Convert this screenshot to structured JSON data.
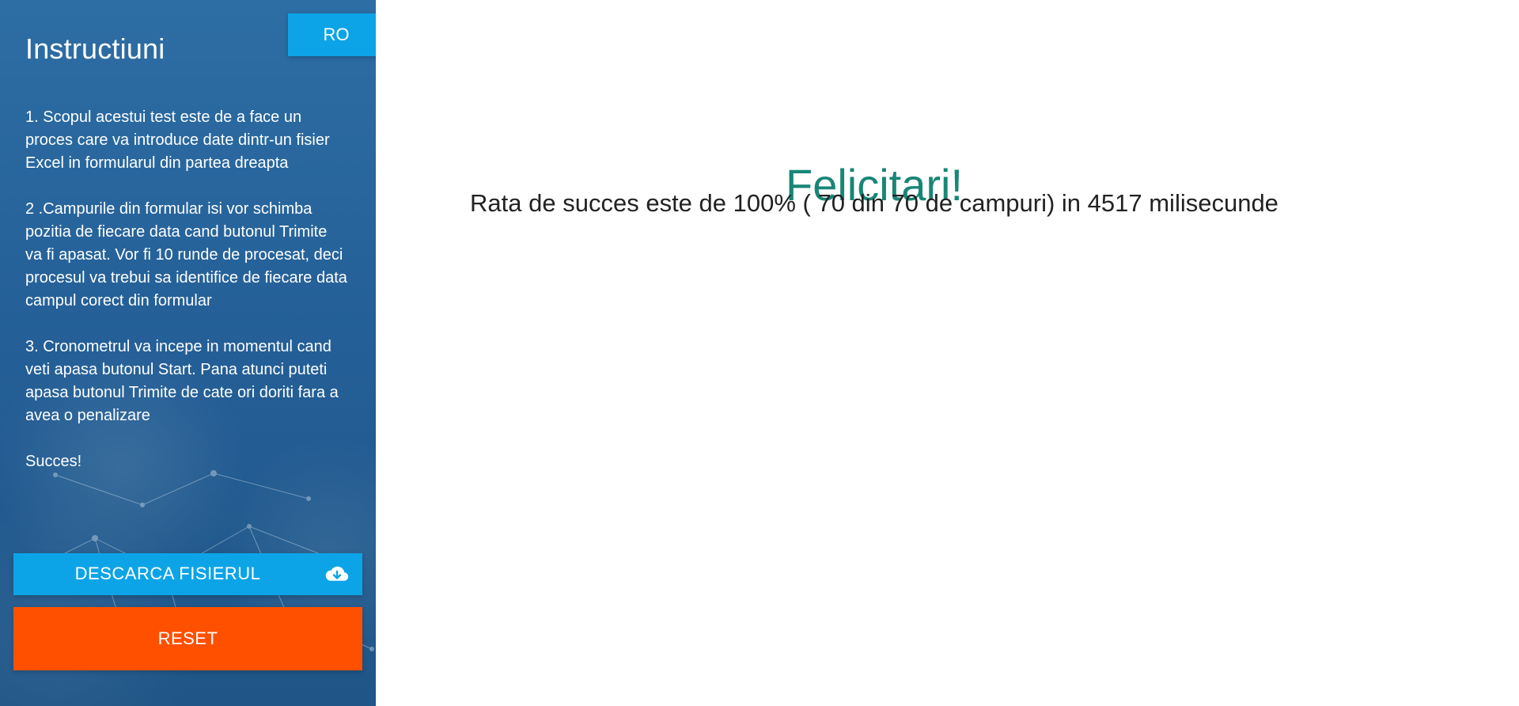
{
  "sidebar": {
    "title": "Instructiuni",
    "language_button": "RO",
    "instructions": [
      "1. Scopul acestui test este de a face un proces care va introduce date dintr-un fisier Excel in formularul din partea dreapta",
      "2 .Campurile din formular isi vor schimba pozitia de fiecare data cand butonul Trimite va fi apasat. Vor fi 10 runde de procesat, deci procesul va trebui sa identifice de fiecare data campul corect din formular",
      "3. Cronometrul va incepe in momentul cand veti apasa butonul Start. Pana atunci puteti apasa butonul Trimite de cate ori doriti fara a avea o penalizare",
      "Succes!"
    ],
    "download_button": "DESCARCA FISIERUL",
    "download_icon": "cloud-download-icon",
    "reset_button": "RESET"
  },
  "main": {
    "title": "Felicitari!",
    "message": "Rata de succes este de 100% ( 70 din 70 de campuri) in 4517 milisecunde"
  },
  "colors": {
    "sidebar_blue": "#245f97",
    "button_blue": "#0da4e7",
    "reset_orange": "#ff5000",
    "success_teal": "#188676",
    "top_accent": "#1f7fd6"
  }
}
